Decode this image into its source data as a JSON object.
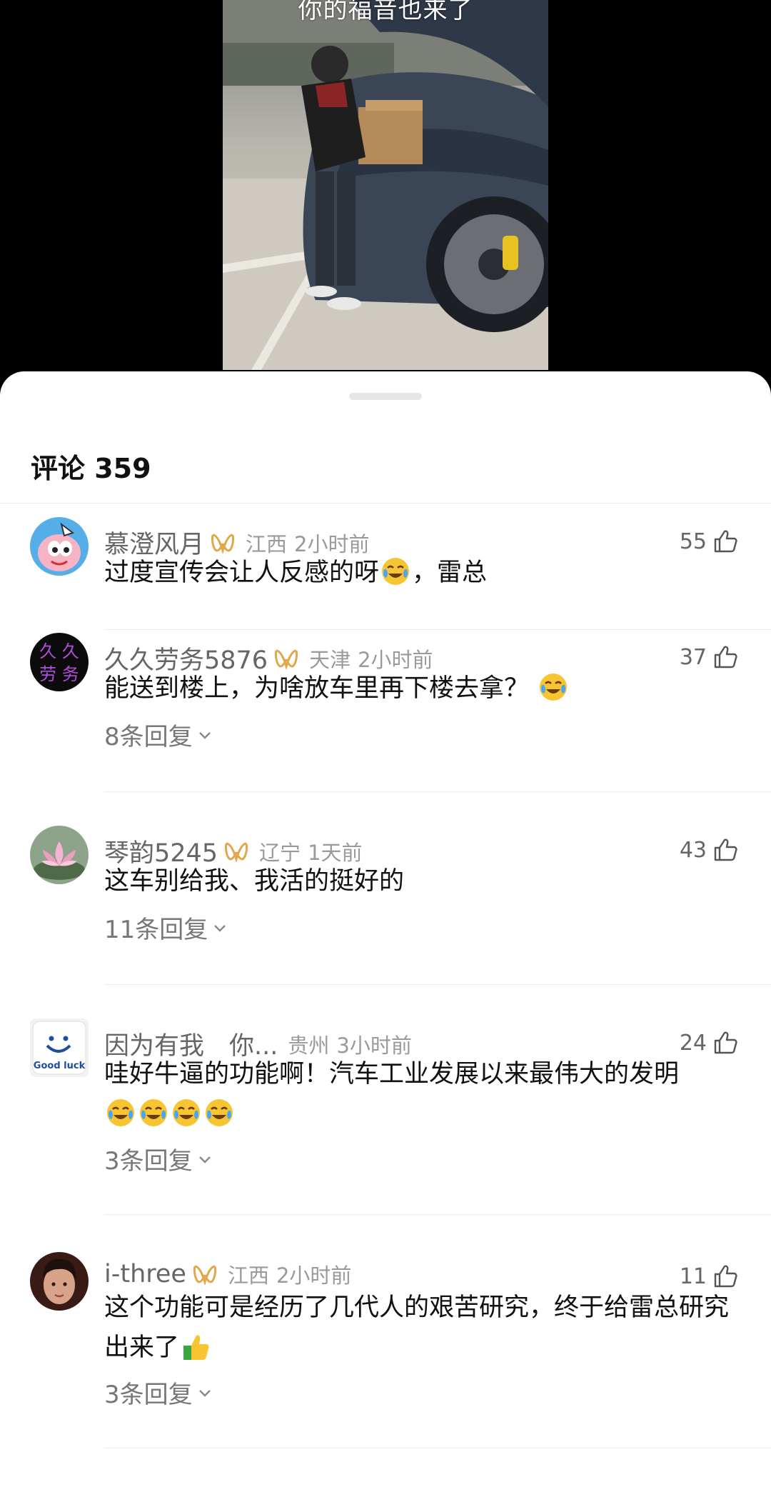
{
  "video": {
    "caption": "你的福音也来了"
  },
  "comments_panel": {
    "title": "评论 359"
  },
  "comments": [
    {
      "username": "慕澄风月",
      "location": "江西",
      "time": "2小时前",
      "likes": "55",
      "text": "过度宣传会让人反感的呀",
      "text_after_emoji": "，雷总",
      "emoji": "crying-laughing",
      "replies": ""
    },
    {
      "username": "久久劳务5876",
      "location": "天津",
      "time": "2小时前",
      "likes": "37",
      "text": "能送到楼上，为啥放车里再下楼去拿？",
      "emoji": "crying-laughing",
      "replies": "8条回复",
      "avatar_text_1": "久 久",
      "avatar_text_2": "劳 务"
    },
    {
      "username": "琴韵5245",
      "location": "辽宁",
      "time": "1天前",
      "likes": "43",
      "text": "这车别给我、我活的挺好的",
      "replies": "11条回复"
    },
    {
      "username": "因为有我　你...",
      "location": "贵州",
      "time": "3小时前",
      "likes": "24",
      "text": "哇好牛逼的功能啊！汽车工业发展以来最伟大的发明",
      "emoji": "crying-laughing x4",
      "replies": "3条回复",
      "avatar_text": "Good luck"
    },
    {
      "username": "i-three",
      "location": "江西",
      "time": "2小时前",
      "likes": "11",
      "text": "这个功能可是经历了几代人的艰苦研究，终于给雷总研究出来了",
      "emoji": "thumbs-up",
      "replies": "3条回复"
    }
  ],
  "colors": {
    "badge_gold": "#e2a64b",
    "text_primary": "#111111",
    "text_secondary": "#666666",
    "text_muted": "#9a9a9a"
  }
}
